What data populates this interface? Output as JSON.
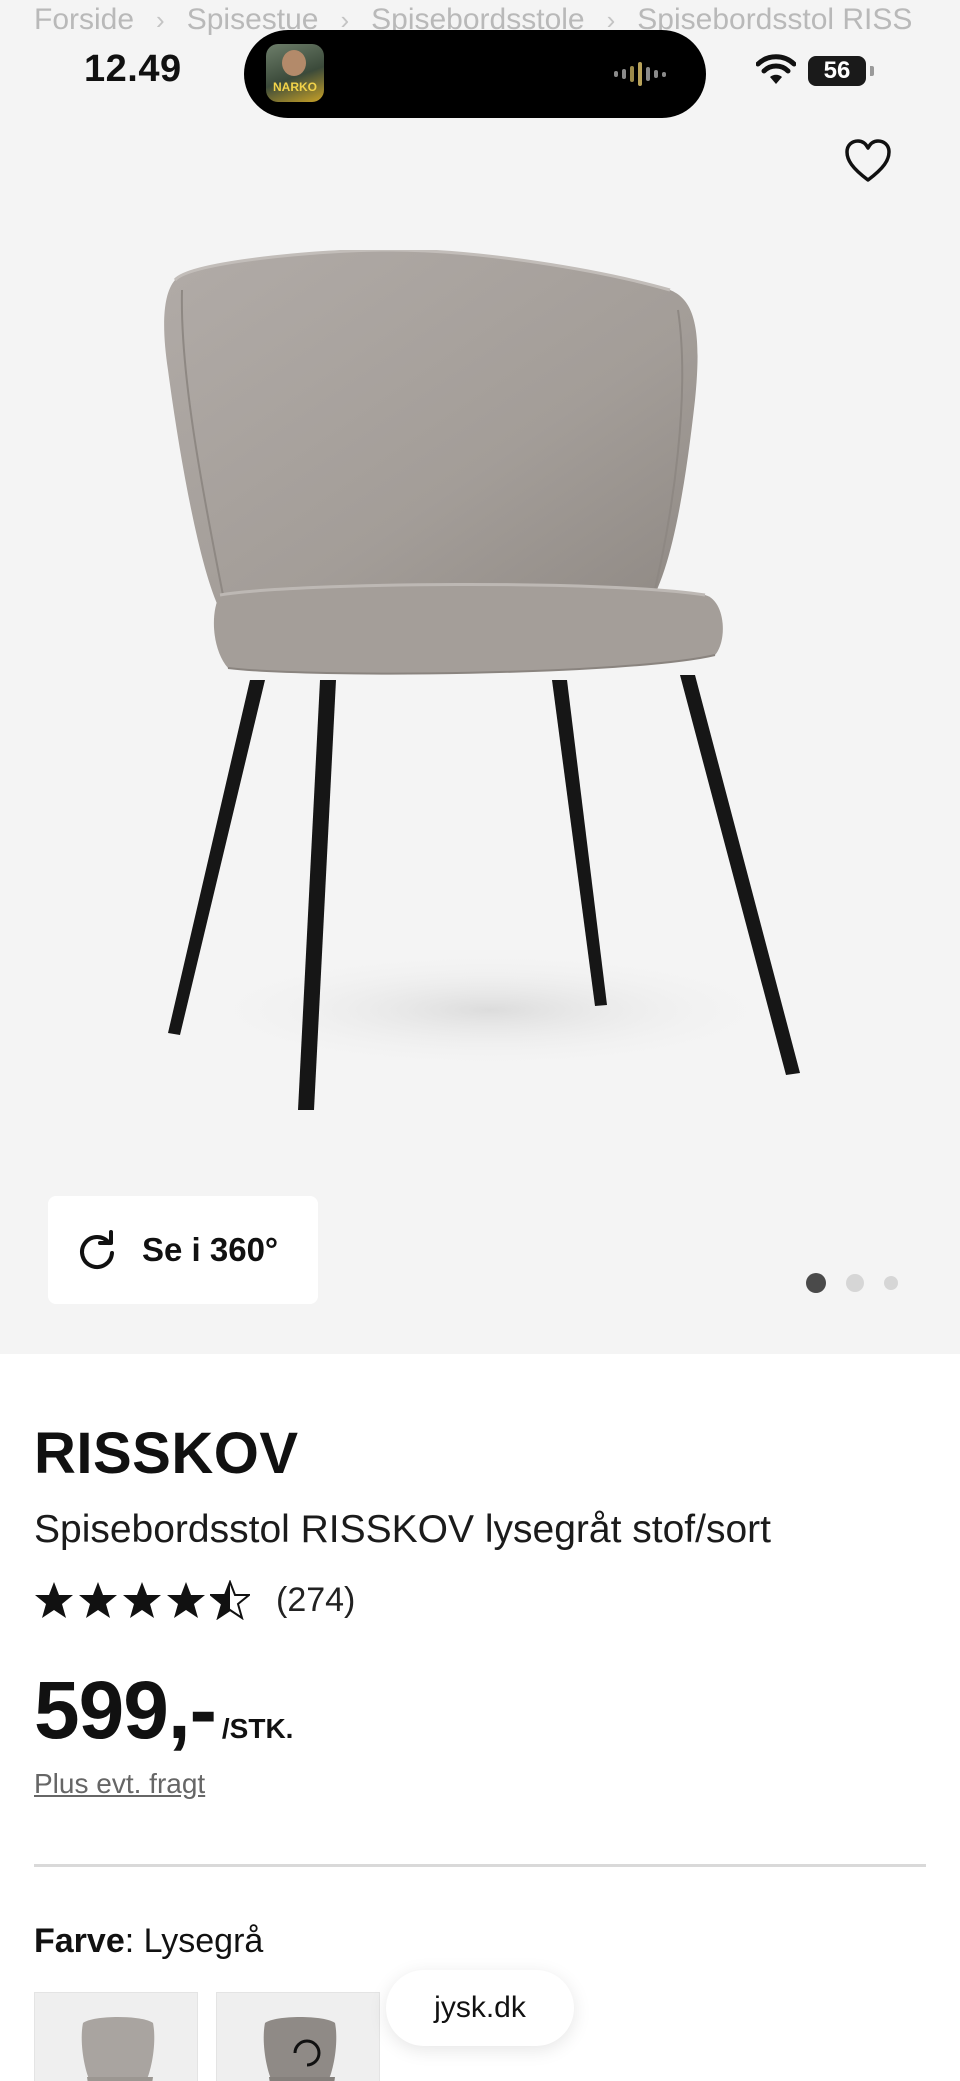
{
  "breadcrumb": {
    "items": [
      "Forside",
      "Spisestue",
      "Spisebordsstole",
      "Spisebordsstol RISS"
    ],
    "separator": "›"
  },
  "status_bar": {
    "time": "12.49",
    "now_playing_badge": "NARKO",
    "battery": "56"
  },
  "gallery": {
    "view_360_label": "Se i 360°",
    "favorite_icon": "heart-outline-icon",
    "rotate_icon": "rotate-icon",
    "dots_count": 3,
    "active_dot": 1
  },
  "product": {
    "brand": "RISSKOV",
    "name": "Spisebordsstol RISSKOV lysegråt stof/sort",
    "rating_stars": 4.5,
    "rating_count": "(274)",
    "price": "599,-",
    "price_unit": "/STK.",
    "freight_link": "Plus evt. fragt",
    "color_key": "Farve",
    "color_value": ": Lysegrå"
  },
  "browser": {
    "url": "jysk.dk"
  },
  "colors": {
    "hero_bg": "#f4f4f4",
    "fabric": "#a8a29e",
    "legs": "#161616",
    "star": "#111111"
  }
}
